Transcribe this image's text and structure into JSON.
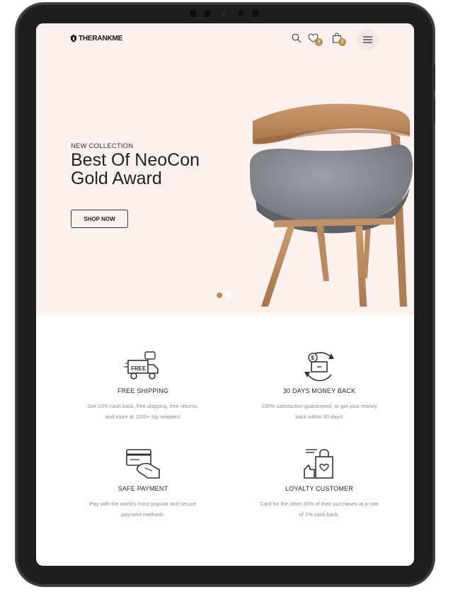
{
  "header": {
    "logo_text": "THERANKME",
    "icons": [
      "search-icon",
      "heart-icon",
      "shopping-bag-icon",
      "menu-icon"
    ],
    "wishlist_count": "3",
    "cart_count": "3"
  },
  "hero": {
    "eyebrow": "NEW COLLECTION",
    "title_line1": "Best Of NeoCon",
    "title_line2": "Gold Award",
    "button_label": "SHOP NOW",
    "slide_count": 2,
    "active_slide": 1
  },
  "features": [
    {
      "icon": "free-shipping-truck-icon",
      "title": "FREE SHIPPING",
      "line1": "Get 10% cash back, free shipping, free returns,",
      "line2": "and more at 1000+ top retailers!"
    },
    {
      "icon": "money-back-icon",
      "title": "30 DAYS MONEY BACK",
      "line1": "100% satisfaction guaranteed, or get your money",
      "line2": "back within 30 days!"
    },
    {
      "icon": "credit-card-hand-icon",
      "title": "SAFE PAYMENT",
      "line1": "Pay with the world's most popular and secure",
      "line2": "payment methods."
    },
    {
      "icon": "loyalty-bag-icon",
      "title": "LOYALTY CUSTOMER",
      "line1": "Card for the other 30% of their purchases at a rate",
      "line2": "of 1% cash back."
    }
  ],
  "colors": {
    "hero_background": "#fbf1ee",
    "accent": "#b9924f",
    "device_frame": "#1e1e1e"
  }
}
